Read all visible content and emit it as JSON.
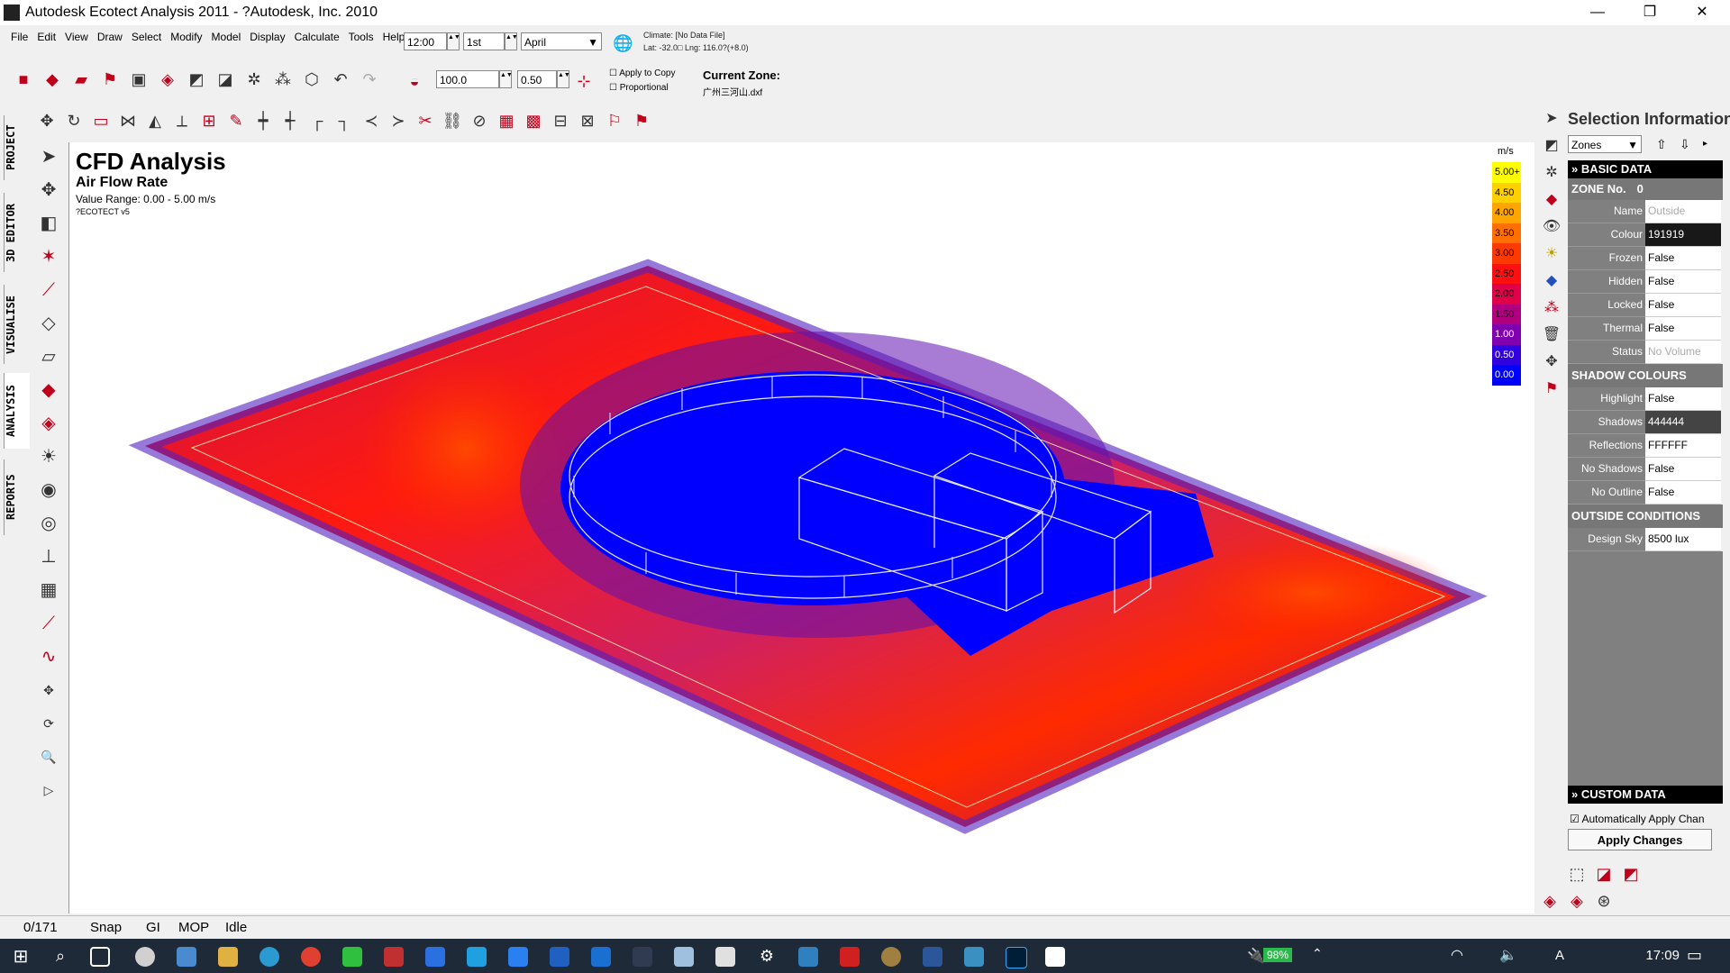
{
  "window": {
    "title": "Autodesk Ecotect Analysis 2011 - ?Autodesk, Inc. 2010",
    "min": "—",
    "max": "❐",
    "close": "✕"
  },
  "menu": [
    "File",
    "Edit",
    "View",
    "Draw",
    "Select",
    "Modify",
    "Model",
    "Display",
    "Calculate",
    "Tools",
    "Help"
  ],
  "toolbar_date": {
    "time": "12:00",
    "day": "1st",
    "month": "April"
  },
  "climate": {
    "line1": "Climate: [No Data File]",
    "line2": "Lat: -32.0□   Lng: 116.0?(+8.0)"
  },
  "scale_inputs": {
    "value1": "100.0",
    "value2": "0.50",
    "apply_to_copy": "Apply to Copy",
    "proportional": "Proportional"
  },
  "current_zone": {
    "label": "Current Zone:",
    "file": "广州三河山.dxf"
  },
  "left_tabs": [
    "PROJECT",
    "3D EDITOR",
    "VISUALISE",
    "ANALYSIS",
    "REPORTS"
  ],
  "analysis": {
    "title": "CFD Analysis",
    "subtitle": "Air Flow Rate",
    "range": "Value Range: 0.00 - 5.00 m/s",
    "credit": "?ECOTECT v5"
  },
  "legend": {
    "unit": "m/s",
    "items": [
      {
        "label": "5.00+",
        "color": "#ffff00"
      },
      {
        "label": "4.50",
        "color": "#ffd000"
      },
      {
        "label": "4.00",
        "color": "#ffa500"
      },
      {
        "label": "3.50",
        "color": "#ff7000"
      },
      {
        "label": "3.00",
        "color": "#ff3a00"
      },
      {
        "label": "2.50",
        "color": "#ff1010"
      },
      {
        "label": "2.00",
        "color": "#e0004a"
      },
      {
        "label": "1.50",
        "color": "#b00080"
      },
      {
        "label": "1.00",
        "color": "#8000b0"
      },
      {
        "label": "0.50",
        "color": "#3000e0"
      },
      {
        "label": "0.00",
        "color": "#0000ff"
      }
    ]
  },
  "selection": {
    "title": "Selection Information",
    "zones_select": "Zones",
    "basic_data": "BASIC DATA",
    "zone_no_label": "ZONE No.",
    "zone_no_value": "0",
    "basic_rows": [
      {
        "k": "Name",
        "v": "Outside"
      },
      {
        "k": "Colour",
        "v": "191919"
      },
      {
        "k": "Frozen",
        "v": "False"
      },
      {
        "k": "Hidden",
        "v": "False"
      },
      {
        "k": "Locked",
        "v": "False"
      },
      {
        "k": "Thermal",
        "v": "False"
      },
      {
        "k": "Status",
        "v": "No Volume"
      }
    ],
    "shadow_colours": "SHADOW COLOURS",
    "shadow_rows": [
      {
        "k": "Highlight",
        "v": "False"
      },
      {
        "k": "Shadows",
        "v": "444444"
      },
      {
        "k": "Reflections",
        "v": "FFFFFF"
      },
      {
        "k": "No Shadows",
        "v": "False"
      },
      {
        "k": "No Outline",
        "v": "False"
      }
    ],
    "outside_conditions": "OUTSIDE CONDITIONS",
    "outside_rows": [
      {
        "k": "Design Sky",
        "v": "8500 lux"
      }
    ],
    "custom_data": "CUSTOM DATA",
    "auto_apply": "Automatically Apply Chan",
    "apply_button": "Apply Changes"
  },
  "status": {
    "count": "0/171",
    "snap": "Snap",
    "gi": "GI",
    "mop": "MOP",
    "state": "Idle"
  },
  "taskbar": {
    "battery": "98%",
    "lang": "A",
    "time": "17:09"
  }
}
